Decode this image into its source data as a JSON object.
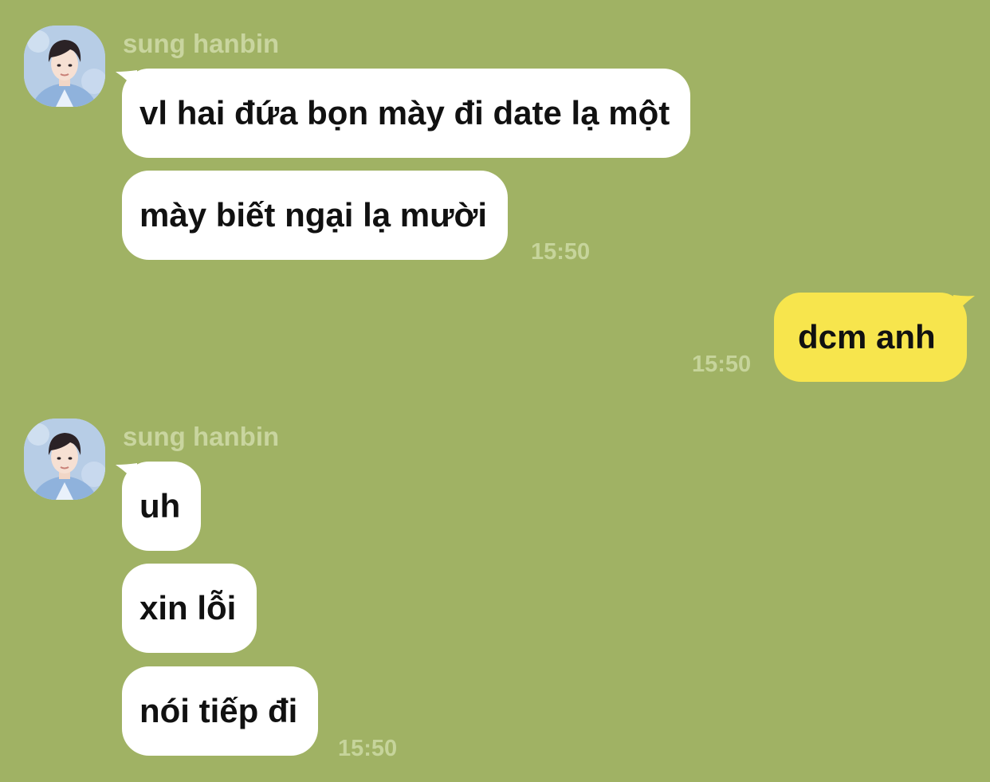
{
  "colors": {
    "background": "#a0b264",
    "incoming_bubble": "#ffffff",
    "outgoing_bubble": "#f7e54d",
    "meta_text": "#c9d59f"
  },
  "groups": [
    {
      "sender": "sung hanbin",
      "avatar_icon": "profile-photo",
      "messages": [
        "vl hai đứa bọn mày đi date lạ một",
        "mày biết ngại lạ mười"
      ],
      "time": "15:50"
    },
    {
      "sender": "me",
      "messages": [
        "dcm anh"
      ],
      "time": "15:50"
    },
    {
      "sender": "sung hanbin",
      "avatar_icon": "profile-photo",
      "messages": [
        "uh",
        "xin lỗi",
        "nói tiếp đi"
      ],
      "time": "15:50"
    }
  ]
}
